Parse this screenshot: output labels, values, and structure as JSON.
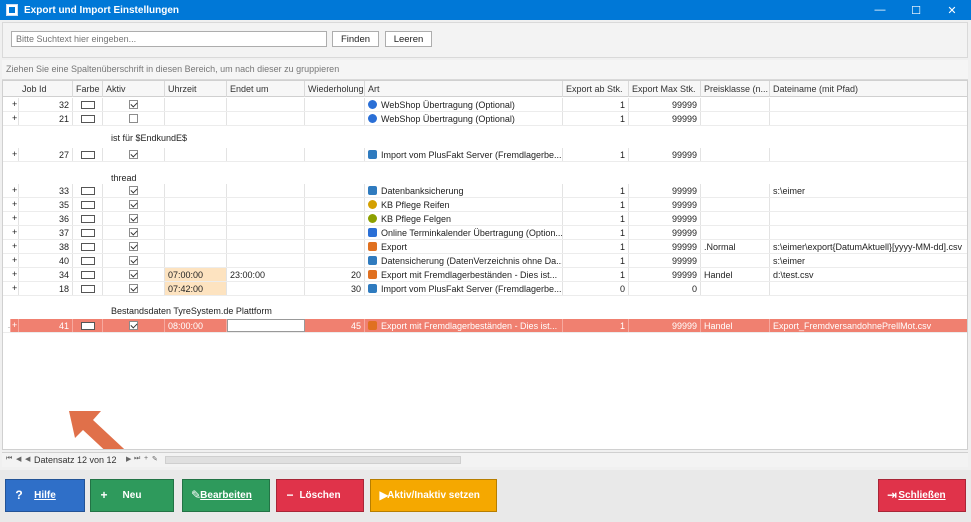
{
  "window": {
    "title": "Export und Import Einstellungen",
    "minimize": "—",
    "maximize": "☐",
    "close": "✕"
  },
  "search": {
    "placeholder": "Bitte Suchtext hier eingeben...",
    "find_label": "Finden",
    "clear_label": "Leeren"
  },
  "group_hint": "Ziehen Sie eine Spaltenüberschrift in diesen Bereich, um nach dieser zu gruppieren",
  "columns": [
    "Job Id",
    "Farbe",
    "Aktiv",
    "Uhrzeit",
    "Endet um",
    "Wiederholung",
    "Art",
    "Export ab Stk.",
    "Export Max Stk.",
    "Preisklasse (n...",
    "Dateiname (mit Pfad)"
  ],
  "rows": [
    {
      "kind": "data",
      "expand": "+",
      "id": "32",
      "aktiv": true,
      "uhrzeit": "",
      "endet": "",
      "wdh": "",
      "art": "WebShop Übertragung (Optional)",
      "icon": "globe-icon",
      "iconColor": "#2a6fd6",
      "ab": "1",
      "max": "99999",
      "preis": "",
      "datei": ""
    },
    {
      "kind": "data",
      "expand": "+",
      "id": "21",
      "aktiv": false,
      "uhrzeit": "",
      "endet": "",
      "wdh": "",
      "art": "WebShop Übertragung (Optional)",
      "icon": "globe-icon",
      "iconColor": "#2a6fd6",
      "ab": "1",
      "max": "99999",
      "preis": "",
      "datei": ""
    },
    {
      "kind": "group",
      "label": "ist für $EndkundE$"
    },
    {
      "kind": "data",
      "expand": "+",
      "id": "27",
      "aktiv": true,
      "uhrzeit": "",
      "endet": "",
      "wdh": "",
      "art": "Import vom PlusFakt Server (Fremdlagerbe...",
      "icon": "download-icon",
      "iconColor": "#2f7bbf",
      "ab": "1",
      "max": "99999",
      "preis": "",
      "datei": ""
    },
    {
      "kind": "group",
      "label": "thread"
    },
    {
      "kind": "data",
      "expand": "+",
      "id": "33",
      "aktiv": true,
      "uhrzeit": "",
      "endet": "",
      "wdh": "",
      "art": "Datenbanksicherung",
      "icon": "database-icon",
      "iconColor": "#2f7bbf",
      "ab": "1",
      "max": "99999",
      "preis": "",
      "datei": "s:\\eimer"
    },
    {
      "kind": "data",
      "expand": "+",
      "id": "35",
      "aktiv": true,
      "uhrzeit": "",
      "endet": "",
      "wdh": "",
      "art": "KB Pflege Reifen",
      "icon": "tire-icon",
      "iconColor": "#d4a000",
      "ab": "1",
      "max": "99999",
      "preis": "",
      "datei": ""
    },
    {
      "kind": "data",
      "expand": "+",
      "id": "36",
      "aktiv": true,
      "uhrzeit": "",
      "endet": "",
      "wdh": "",
      "art": "KB Pflege Felgen",
      "icon": "rim-icon",
      "iconColor": "#8ca000",
      "ab": "1",
      "max": "99999",
      "preis": "",
      "datei": ""
    },
    {
      "kind": "data",
      "expand": "+",
      "id": "37",
      "aktiv": true,
      "uhrzeit": "",
      "endet": "",
      "wdh": "",
      "art": "Online Terminkalender Übertragung (Option...",
      "icon": "calendar-icon",
      "iconColor": "#2a6fd6",
      "ab": "1",
      "max": "99999",
      "preis": "",
      "datei": ""
    },
    {
      "kind": "data",
      "expand": "+",
      "id": "38",
      "aktiv": true,
      "uhrzeit": "",
      "endet": "",
      "wdh": "",
      "art": "Export",
      "icon": "upload-icon",
      "iconColor": "#e07020",
      "ab": "1",
      "max": "99999",
      "preis": ".Normal",
      "datei": "s:\\eimer\\export{DatumAktuell}[yyyy-MM-dd].csv"
    },
    {
      "kind": "data",
      "expand": "+",
      "id": "40",
      "aktiv": true,
      "uhrzeit": "",
      "endet": "",
      "wdh": "",
      "art": "Datensicherung (DatenVerzeichnis ohne Da...",
      "icon": "backup-icon",
      "iconColor": "#2f7bbf",
      "ab": "1",
      "max": "99999",
      "preis": "",
      "datei": "s:\\eimer"
    },
    {
      "kind": "data",
      "expand": "+",
      "id": "34",
      "aktiv": true,
      "uhrzeit": "07:00:00",
      "endet": "23:00:00",
      "wdh": "20",
      "art": "Export mit Fremdlagerbeständen - Dies ist...",
      "icon": "upload-icon",
      "iconColor": "#e07020",
      "ab": "1",
      "max": "99999",
      "preis": "Handel",
      "datei": "d:\\test.csv"
    },
    {
      "kind": "data",
      "expand": "+",
      "id": "18",
      "aktiv": true,
      "uhrzeit": "07:42:00",
      "endet": "",
      "wdh": "30",
      "art": "Import vom PlusFakt Server (Fremdlagerbe...",
      "icon": "download-icon",
      "iconColor": "#2f7bbf",
      "ab": "0",
      "max": "0",
      "preis": "",
      "datei": ""
    },
    {
      "kind": "group",
      "label": "Bestandsdaten TyreSystem.de Plattform"
    },
    {
      "kind": "selected",
      "expand": "+",
      "id": "41",
      "aktiv": true,
      "uhrzeit": "08:00:00",
      "endet": "",
      "wdh": "45",
      "art": "Export mit Fremdlagerbeständen - Dies ist...",
      "icon": "upload-icon",
      "iconColor": "#e07020",
      "ab": "1",
      "max": "99999",
      "preis": "Handel",
      "datei": "Export_FremdversandohnePrellMot.csv"
    }
  ],
  "navigator": {
    "label": "Datensatz 12 von 12"
  },
  "buttons": [
    {
      "label": "Hilfe",
      "color": "#2f6fc8"
    },
    {
      "label": "Neu",
      "color": "#2e9a5c"
    },
    {
      "label": "Bearbeiten",
      "color": "#2e9a5c"
    },
    {
      "label": "Löschen",
      "color": "#e0334a"
    },
    {
      "label": "Aktiv/Inaktiv setzen",
      "color": "#f5a800"
    },
    {
      "label": "Schließen",
      "color": "#e0334a"
    }
  ],
  "annotation_arrow_color": "#e0704a"
}
